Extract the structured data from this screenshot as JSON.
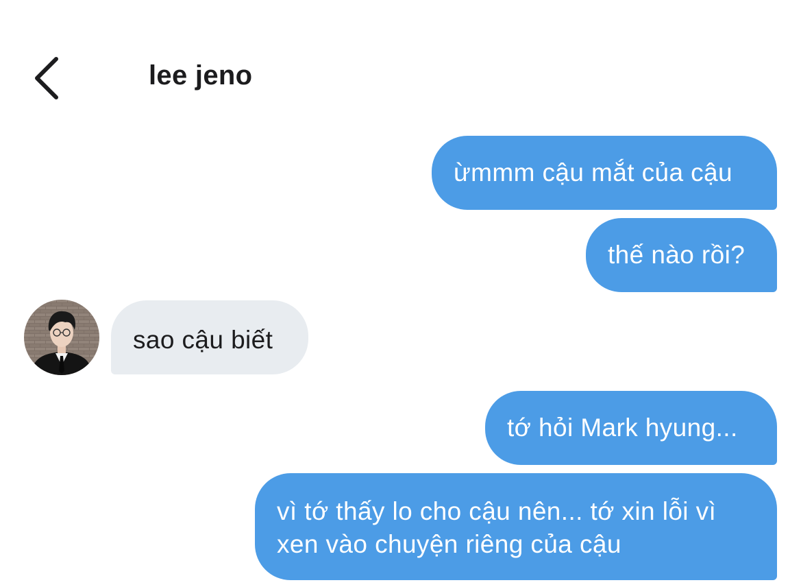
{
  "header": {
    "back_icon": "chevron-left-icon",
    "contact_name": "lee jeno"
  },
  "conversation": {
    "messages": [
      {
        "direction": "sent",
        "text": "ừmmm cậu mắt của cậu"
      },
      {
        "direction": "sent",
        "text": "thế nào rồi?"
      },
      {
        "direction": "received",
        "text": "sao cậu biết"
      },
      {
        "direction": "sent",
        "text": "tớ hỏi Mark hyung..."
      },
      {
        "direction": "sent",
        "text": "vì tớ thấy lo cho cậu nên... tớ xin lỗi vì xen vào chuyện riêng của cậu"
      }
    ]
  },
  "colors": {
    "sent_bubble": "#4c9ce6",
    "received_bubble": "#e8ecf0",
    "text_dark": "#1c1c1e",
    "background": "#ffffff"
  }
}
